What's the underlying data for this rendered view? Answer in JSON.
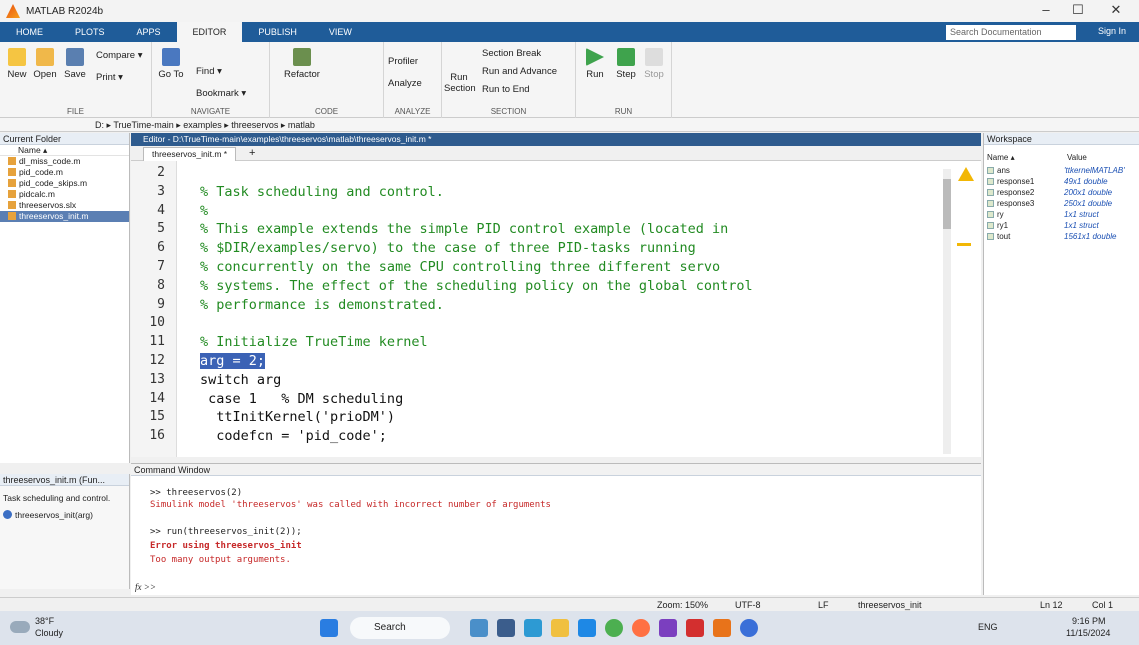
{
  "window": {
    "title": "MATLAB R2024b",
    "min": "–",
    "max": "☐",
    "close": "✕"
  },
  "ribbon_tabs": [
    "HOME",
    "PLOTS",
    "APPS",
    "EDITOR",
    "PUBLISH",
    "VIEW"
  ],
  "search_placeholder": "Search Documentation",
  "sign_in": "Sign In",
  "ribbon": {
    "file": {
      "label": "FILE",
      "new": "New",
      "open": "Open",
      "save": "Save",
      "compare": "Compare ▾",
      "print": "Print ▾"
    },
    "navigate": {
      "label": "NAVIGATE",
      "goto": "Go To",
      "find": "Find ▾",
      "bookmark": "Bookmark ▾"
    },
    "code": {
      "label": "CODE",
      "refactor": "Refactor"
    },
    "analyze": {
      "label": "ANALYZE",
      "profiler": "Profiler",
      "analyze": "Analyze"
    },
    "section": {
      "label": "SECTION",
      "section_break": "Section Break",
      "run_advance": "Run and Advance",
      "run_section": "Run Section",
      "run_to_end": "Run to End"
    },
    "run": {
      "label": "RUN",
      "run": "Run",
      "step": "Step",
      "stop": "Stop"
    }
  },
  "path": [
    "D:",
    "TrueTime-main",
    "examples",
    "threeservos",
    "matlab"
  ],
  "current_folder": {
    "title": "Current Folder",
    "name_col": "Name ▴",
    "files": [
      "dl_miss_code.m",
      "pid_code.m",
      "pid_code_skips.m",
      "pidcalc.m",
      "threeservos.slx",
      "threeservos_init.m"
    ],
    "selected": 5
  },
  "details": {
    "title": "threeservos_init.m (Fun...",
    "desc": "Task scheduling and control.",
    "func": "threeservos_init(arg)"
  },
  "editor": {
    "header": "Editor - D:\\TrueTime-main\\examples\\threeservos\\matlab\\threeservos_init.m *",
    "tab": "threeservos_init.m *",
    "lines": [
      {
        "n": "2",
        "t": ""
      },
      {
        "n": "3",
        "t": "% Task scheduling and control."
      },
      {
        "n": "4",
        "t": "%"
      },
      {
        "n": "5",
        "t": "% This example extends the simple PID control example (located in"
      },
      {
        "n": "6",
        "t": "% $DIR/examples/servo) to the case of three PID-tasks running"
      },
      {
        "n": "7",
        "t": "% concurrently on the same CPU controlling three different servo"
      },
      {
        "n": "8",
        "t": "% systems. The effect of the scheduling policy on the global control"
      },
      {
        "n": "9",
        "t": "% performance is demonstrated."
      },
      {
        "n": "10",
        "t": ""
      },
      {
        "n": "11",
        "t": "% Initialize TrueTime kernel"
      },
      {
        "n": "12",
        "t": "arg = 2;"
      },
      {
        "n": "13",
        "t": "switch arg"
      },
      {
        "n": "14",
        "t": " case 1   % DM scheduling"
      },
      {
        "n": "15",
        "t": "  ttInitKernel('prioDM')"
      },
      {
        "n": "16",
        "t": "  codefcn = 'pid_code';"
      }
    ]
  },
  "command_window": {
    "title": "Command Window",
    "lines": [
      ">> threeservos(2)",
      "Simulink model 'threeservos' was called with incorrect number of arguments",
      ">> run(threeservos_init(2));",
      "Error using threeservos_init",
      "Too many output arguments."
    ],
    "prompt": "fx >>"
  },
  "workspace": {
    "title": "Workspace",
    "name_col": "Name ▴",
    "value_col": "Value",
    "vars": [
      {
        "name": "ans",
        "value": "'ttkernelMATLAB'"
      },
      {
        "name": "response1",
        "value": "49x1 double"
      },
      {
        "name": "response2",
        "value": "200x1 double"
      },
      {
        "name": "response3",
        "value": "250x1 double"
      },
      {
        "name": "ry",
        "value": "1x1 struct"
      },
      {
        "name": "ry1",
        "value": "1x1 struct"
      },
      {
        "name": "tout",
        "value": "1561x1 double"
      }
    ]
  },
  "status": {
    "zoom": "Zoom: 150%",
    "enc": "UTF-8",
    "eol": "LF",
    "func": "threeservos_init",
    "ln": "Ln  12",
    "col": "Col  1"
  },
  "taskbar": {
    "temp": "38°F",
    "weather": "Cloudy",
    "search": "Search",
    "lang": "ENG",
    "time": "9:16 PM",
    "date": "11/15/2024"
  }
}
